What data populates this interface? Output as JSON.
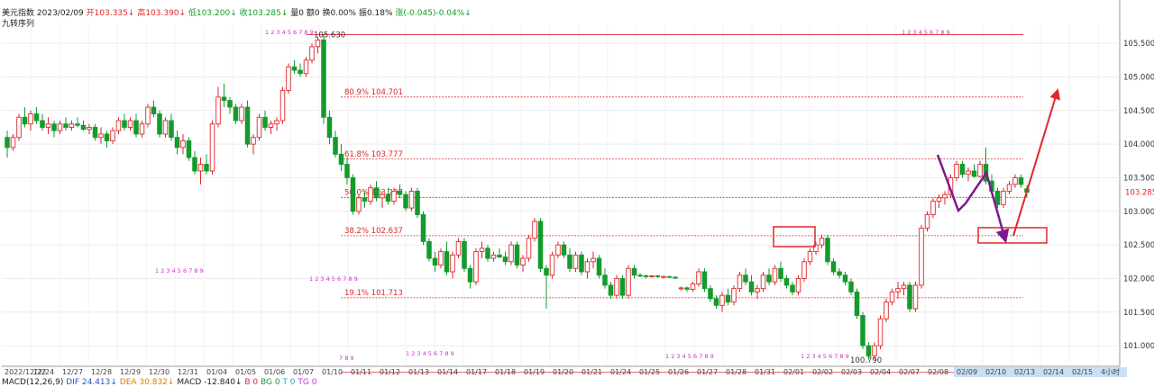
{
  "header": {
    "name": "美元指数",
    "date": "2023/02/09",
    "open_label": "开",
    "open": "103.335",
    "open_arrow": "↓",
    "high_label": "高",
    "high": "103.390",
    "high_arrow": "↓",
    "low_label": "低",
    "low": "103.200",
    "low_arrow": "↓",
    "close_label": "收",
    "close": "103.285",
    "close_arrow": "↓",
    "volume": "量0",
    "amount": "额0",
    "turnover": "换0.00%",
    "amplitude": "振0.18%",
    "change": "涨(-0.045)-0.04%",
    "change_arrow": "↓",
    "subtitle": "九转序列"
  },
  "macd": {
    "label": "MACD(12,26,9)",
    "dif": "DIF 24.413",
    "dif_arrow": "↓",
    "dea": "DEA 30.832",
    "dea_arrow": "↓",
    "macd": "MACD -12.840",
    "macd_arrow": "↓",
    "b": "B 0",
    "bg": "BG 0",
    "t": "T 0",
    "tg": "TG 0"
  },
  "colors": {
    "up": "#e0262b",
    "down": "#139b2c",
    "fib": "#e0262b",
    "arrow_purple": "#7a1a8c",
    "seq_magenta": "#d02bd0",
    "seq_green": "#25b425",
    "price_box": "#e0262b"
  },
  "chart_data": {
    "type": "candlestick",
    "y_range": [
      100.72,
      105.77
    ],
    "y_ticks": [
      "101.000",
      "101.500",
      "102.000",
      "102.500",
      "103.000",
      "103.500",
      "104.000",
      "104.500",
      "105.000",
      "105.500"
    ],
    "last_price": "103.285",
    "x_ticks": [
      "2022/12/22",
      "12/24",
      "12/27",
      "12/28",
      "12/29",
      "12/30",
      "12/31",
      "01/04",
      "01/05",
      "01/06",
      "01/07",
      "01/10",
      "01/11",
      "01/12",
      "01/13",
      "01/14",
      "01/17",
      "01/18",
      "01/19",
      "01/20",
      "01/21",
      "01/24",
      "01/25",
      "01/26",
      "01/27",
      "01/28",
      "01/31",
      "02/01",
      "02/02",
      "02/03",
      "02/04",
      "02/07",
      "02/08",
      "02/09",
      "02/10",
      "02/13",
      "02/14",
      "02/15",
      "4小时"
    ],
    "high_marker": {
      "label": "105.630",
      "value": 105.63
    },
    "low_marker": {
      "label": "100.790",
      "value": 100.79
    },
    "fib_levels": [
      {
        "label": "80.9% 104.701",
        "value": 104.701
      },
      {
        "label": "61.8% 103.777",
        "value": 103.777
      },
      {
        "label": "50.0% 103.207",
        "value": 103.207
      },
      {
        "label": "38.2% 102.637",
        "value": 102.637
      },
      {
        "label": "19.1% 101.713",
        "value": 101.713
      }
    ],
    "sequence_rows": [
      "1 2 3 4 5 6 7 8 9",
      "1 2 3 4 5 6 7 8 9",
      "1 2 3 4 5 6 7 8 9",
      "1 2 3 4 5 6 7 8 9",
      "7 8 9"
    ],
    "candles": [
      [
        104.1,
        104.2,
        103.8,
        103.95
      ],
      [
        103.95,
        104.15,
        103.9,
        104.1
      ],
      [
        104.1,
        104.45,
        104.05,
        104.4
      ],
      [
        104.4,
        104.55,
        104.25,
        104.3
      ],
      [
        104.3,
        104.5,
        104.2,
        104.45
      ],
      [
        104.45,
        104.55,
        104.3,
        104.35
      ],
      [
        104.35,
        104.45,
        104.2,
        104.25
      ],
      [
        104.25,
        104.4,
        104.15,
        104.3
      ],
      [
        104.3,
        104.35,
        104.1,
        104.2
      ],
      [
        104.2,
        104.35,
        104.15,
        104.3
      ],
      [
        104.3,
        104.4,
        104.2,
        104.25
      ],
      [
        104.25,
        104.35,
        104.2,
        104.3
      ],
      [
        104.3,
        104.4,
        104.25,
        104.28
      ],
      [
        104.28,
        104.35,
        104.2,
        104.22
      ],
      [
        104.22,
        104.3,
        104.15,
        104.25
      ],
      [
        104.25,
        104.3,
        104.05,
        104.1
      ],
      [
        104.1,
        104.25,
        104.0,
        104.15
      ],
      [
        104.15,
        104.2,
        103.95,
        104.05
      ],
      [
        104.05,
        104.25,
        104.0,
        104.2
      ],
      [
        104.2,
        104.4,
        104.15,
        104.35
      ],
      [
        104.35,
        104.45,
        104.2,
        104.25
      ],
      [
        104.25,
        104.4,
        104.2,
        104.35
      ],
      [
        104.35,
        104.45,
        104.1,
        104.15
      ],
      [
        104.15,
        104.35,
        104.1,
        104.3
      ],
      [
        104.3,
        104.6,
        104.25,
        104.55
      ],
      [
        104.55,
        104.65,
        104.4,
        104.45
      ],
      [
        104.45,
        104.5,
        104.1,
        104.15
      ],
      [
        104.15,
        104.4,
        104.1,
        104.35
      ],
      [
        104.35,
        104.45,
        104.05,
        104.1
      ],
      [
        104.1,
        104.2,
        103.85,
        103.95
      ],
      [
        103.95,
        104.15,
        103.85,
        104.05
      ],
      [
        104.05,
        104.1,
        103.75,
        103.8
      ],
      [
        103.8,
        103.9,
        103.55,
        103.6
      ],
      [
        103.6,
        103.8,
        103.4,
        103.7
      ],
      [
        103.7,
        103.85,
        103.55,
        103.6
      ],
      [
        103.6,
        104.35,
        103.55,
        104.3
      ],
      [
        104.3,
        104.85,
        104.25,
        104.7
      ],
      [
        104.7,
        104.9,
        104.55,
        104.65
      ],
      [
        104.65,
        104.7,
        104.45,
        104.55
      ],
      [
        104.55,
        104.6,
        104.3,
        104.35
      ],
      [
        104.35,
        104.6,
        104.3,
        104.55
      ],
      [
        104.55,
        104.65,
        103.95,
        104.0
      ],
      [
        104.0,
        104.15,
        103.85,
        104.1
      ],
      [
        104.1,
        104.45,
        104.05,
        104.4
      ],
      [
        104.4,
        104.5,
        104.2,
        104.25
      ],
      [
        104.25,
        104.35,
        104.15,
        104.3
      ],
      [
        104.3,
        104.4,
        104.2,
        104.35
      ],
      [
        104.35,
        104.85,
        104.3,
        104.8
      ],
      [
        104.8,
        105.2,
        104.75,
        105.15
      ],
      [
        105.15,
        105.25,
        105.05,
        105.1
      ],
      [
        105.1,
        105.2,
        105.0,
        105.05
      ],
      [
        105.05,
        105.3,
        105.0,
        105.25
      ],
      [
        105.25,
        105.5,
        105.2,
        105.45
      ],
      [
        105.45,
        105.6,
        105.35,
        105.55
      ],
      [
        105.55,
        105.63,
        104.3,
        104.4
      ],
      [
        104.4,
        104.5,
        104.0,
        104.1
      ],
      [
        104.1,
        104.2,
        103.8,
        103.85
      ],
      [
        103.85,
        104.0,
        103.6,
        103.7
      ],
      [
        103.7,
        103.8,
        103.4,
        103.5
      ],
      [
        103.5,
        103.55,
        102.95,
        103.0
      ],
      [
        103.0,
        103.25,
        102.95,
        103.2
      ],
      [
        103.2,
        103.3,
        103.05,
        103.15
      ],
      [
        103.15,
        103.4,
        103.1,
        103.35
      ],
      [
        103.35,
        103.45,
        103.15,
        103.2
      ],
      [
        103.2,
        103.3,
        103.05,
        103.25
      ],
      [
        103.25,
        103.35,
        103.1,
        103.15
      ],
      [
        103.15,
        103.35,
        103.1,
        103.3
      ],
      [
        103.3,
        103.4,
        103.2,
        103.25
      ],
      [
        103.25,
        103.3,
        103.0,
        103.05
      ],
      [
        103.05,
        103.35,
        103.0,
        103.3
      ],
      [
        103.3,
        103.35,
        102.9,
        102.95
      ],
      [
        102.95,
        103.0,
        102.5,
        102.55
      ],
      [
        102.55,
        102.6,
        102.25,
        102.3
      ],
      [
        102.3,
        102.4,
        102.1,
        102.2
      ],
      [
        102.2,
        102.45,
        102.15,
        102.4
      ],
      [
        102.4,
        102.55,
        102.05,
        102.1
      ],
      [
        102.1,
        102.4,
        102.0,
        102.35
      ],
      [
        102.35,
        102.6,
        102.3,
        102.55
      ],
      [
        102.55,
        102.6,
        102.1,
        102.15
      ],
      [
        102.15,
        102.2,
        101.85,
        101.95
      ],
      [
        101.95,
        102.45,
        101.9,
        102.4
      ],
      [
        102.4,
        102.55,
        102.3,
        102.45
      ],
      [
        102.45,
        102.5,
        102.25,
        102.3
      ],
      [
        102.3,
        102.4,
        102.25,
        102.35
      ],
      [
        102.35,
        102.45,
        102.3,
        102.32
      ],
      [
        102.32,
        102.4,
        102.2,
        102.25
      ],
      [
        102.25,
        102.55,
        102.2,
        102.5
      ],
      [
        102.5,
        102.55,
        102.15,
        102.2
      ],
      [
        102.2,
        102.35,
        102.1,
        102.3
      ],
      [
        102.3,
        102.65,
        102.25,
        102.6
      ],
      [
        102.6,
        102.9,
        102.55,
        102.85
      ],
      [
        102.85,
        102.9,
        102.1,
        102.15
      ],
      [
        102.15,
        102.2,
        101.55,
        102.05
      ],
      [
        102.05,
        102.4,
        102.0,
        102.35
      ],
      [
        102.35,
        102.55,
        102.3,
        102.5
      ],
      [
        102.5,
        102.55,
        102.3,
        102.35
      ],
      [
        102.35,
        102.45,
        102.1,
        102.15
      ],
      [
        102.15,
        102.4,
        102.1,
        102.35
      ],
      [
        102.35,
        102.4,
        102.05,
        102.1
      ],
      [
        102.1,
        102.3,
        102.0,
        102.25
      ],
      [
        102.25,
        102.4,
        102.15,
        102.3
      ],
      [
        102.3,
        102.35,
        102.0,
        102.05
      ],
      [
        102.05,
        102.15,
        101.85,
        101.9
      ],
      [
        101.9,
        101.95,
        101.7,
        101.75
      ],
      [
        101.75,
        102.05,
        101.7,
        102.0
      ],
      [
        102.0,
        102.05,
        101.7,
        101.75
      ],
      [
        101.75,
        102.2,
        101.7,
        102.15
      ],
      [
        102.15,
        102.2,
        102.0,
        102.05
      ],
      [
        102.05,
        102.08,
        102.02,
        102.04
      ],
      [
        102.04,
        102.06,
        102.0,
        102.03
      ],
      [
        102.03,
        102.05,
        102.01,
        102.04
      ],
      [
        102.04,
        102.05,
        102.01,
        102.03
      ],
      [
        102.03,
        102.04,
        102.0,
        102.03
      ],
      [
        102.03,
        102.04,
        102.01,
        102.02
      ],
      [
        102.02,
        102.03,
        101.99,
        102.01
      ],
      [
        101.85,
        101.88,
        101.82,
        101.86
      ],
      [
        101.86,
        101.88,
        101.8,
        101.84
      ],
      [
        101.84,
        101.95,
        101.8,
        101.92
      ],
      [
        101.92,
        102.15,
        101.88,
        102.1
      ],
      [
        102.1,
        102.15,
        101.8,
        101.85
      ],
      [
        101.85,
        101.9,
        101.65,
        101.7
      ],
      [
        101.7,
        101.75,
        101.55,
        101.6
      ],
      [
        101.6,
        101.8,
        101.5,
        101.75
      ],
      [
        101.75,
        101.85,
        101.6,
        101.65
      ],
      [
        101.65,
        101.9,
        101.6,
        101.85
      ],
      [
        101.85,
        102.1,
        101.8,
        102.05
      ],
      [
        102.05,
        102.15,
        101.9,
        101.95
      ],
      [
        101.95,
        102.05,
        101.75,
        101.8
      ],
      [
        101.8,
        101.9,
        101.7,
        101.85
      ],
      [
        101.85,
        102.1,
        101.8,
        102.05
      ],
      [
        102.05,
        102.15,
        101.9,
        101.95
      ],
      [
        101.95,
        102.2,
        101.9,
        102.15
      ],
      [
        102.15,
        102.25,
        101.95,
        102.0
      ],
      [
        102.0,
        102.05,
        101.85,
        101.9
      ],
      [
        101.9,
        101.95,
        101.75,
        101.8
      ],
      [
        101.8,
        102.05,
        101.75,
        102.0
      ],
      [
        102.0,
        102.3,
        101.95,
        102.25
      ],
      [
        102.25,
        102.45,
        102.2,
        102.4
      ],
      [
        102.4,
        102.55,
        102.35,
        102.5
      ],
      [
        102.5,
        102.65,
        102.45,
        102.6
      ],
      [
        102.6,
        102.65,
        102.2,
        102.25
      ],
      [
        102.25,
        102.3,
        102.05,
        102.1
      ],
      [
        102.1,
        102.15,
        102.0,
        102.05
      ],
      [
        102.05,
        102.1,
        101.9,
        101.95
      ],
      [
        101.95,
        102.0,
        101.75,
        101.8
      ],
      [
        101.8,
        101.85,
        101.4,
        101.45
      ],
      [
        101.45,
        101.5,
        100.95,
        101.0
      ],
      [
        101.0,
        101.05,
        100.79,
        100.85
      ],
      [
        100.85,
        101.05,
        100.8,
        101.0
      ],
      [
        101.0,
        101.45,
        100.95,
        101.4
      ],
      [
        101.4,
        101.7,
        101.35,
        101.65
      ],
      [
        101.65,
        101.85,
        101.6,
        101.8
      ],
      [
        101.8,
        101.95,
        101.7,
        101.85
      ],
      [
        101.85,
        101.95,
        101.75,
        101.9
      ],
      [
        101.9,
        101.95,
        101.5,
        101.55
      ],
      [
        101.55,
        101.95,
        101.5,
        101.9
      ],
      [
        101.9,
        102.8,
        101.85,
        102.75
      ],
      [
        102.75,
        103.0,
        102.7,
        102.95
      ],
      [
        102.95,
        103.2,
        102.9,
        103.15
      ],
      [
        103.15,
        103.25,
        103.05,
        103.2
      ],
      [
        103.2,
        103.3,
        103.1,
        103.25
      ],
      [
        103.25,
        103.55,
        103.2,
        103.5
      ],
      [
        103.5,
        103.75,
        103.45,
        103.7
      ],
      [
        103.7,
        103.75,
        103.5,
        103.55
      ],
      [
        103.55,
        103.65,
        103.45,
        103.6
      ],
      [
        103.6,
        103.7,
        103.5,
        103.52
      ],
      [
        103.52,
        103.75,
        103.5,
        103.7
      ],
      [
        103.7,
        103.95,
        103.4,
        103.45
      ],
      [
        103.45,
        103.55,
        103.25,
        103.3
      ],
      [
        103.3,
        103.35,
        103.05,
        103.1
      ],
      [
        103.1,
        103.35,
        103.05,
        103.3
      ],
      [
        103.3,
        103.45,
        103.25,
        103.4
      ],
      [
        103.4,
        103.55,
        103.35,
        103.5
      ],
      [
        103.5,
        103.55,
        103.35,
        103.4
      ],
      [
        103.335,
        103.39,
        103.2,
        103.285
      ]
    ]
  }
}
